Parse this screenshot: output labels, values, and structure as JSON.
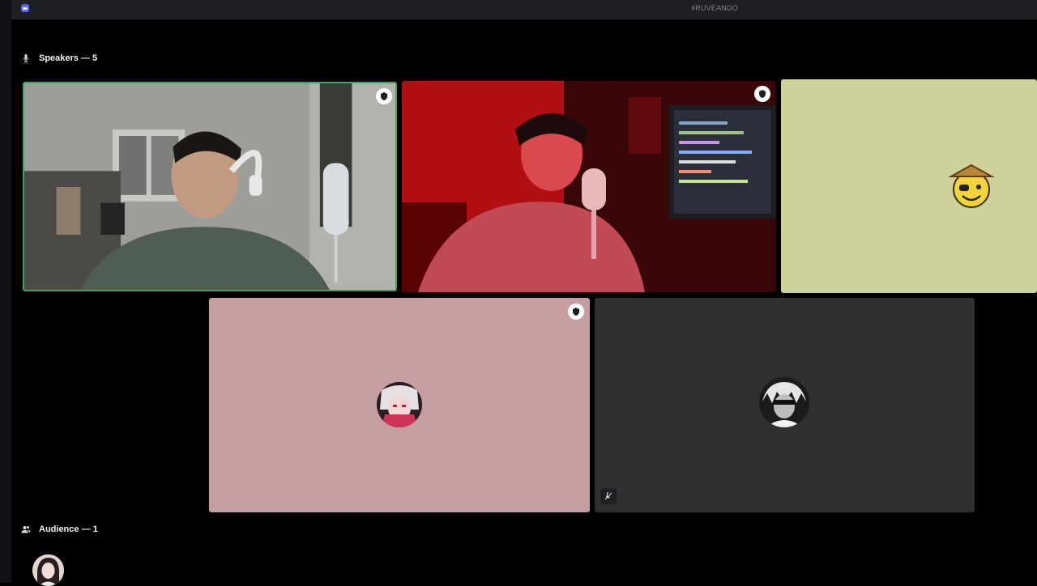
{
  "window": {
    "channel_name": "#RUVEANDO",
    "app_icon": "discord-icon"
  },
  "speakers": {
    "header": "Speakers — 5",
    "icon": "microphone-icon"
  },
  "audience": {
    "header": "Audience — 1",
    "icon": "users-icon"
  },
  "tiles": [
    {
      "type": "video",
      "speaking": true,
      "moderator": true
    },
    {
      "type": "video",
      "speaking": false,
      "moderator": true
    },
    {
      "type": "avatar",
      "background": "#cfd19a",
      "moderator": false
    },
    {
      "type": "avatar",
      "background": "#c69ea2",
      "moderator": true
    },
    {
      "type": "avatar",
      "background": "#2f2f2f",
      "muted": true
    }
  ],
  "colors": {
    "speaking_ring": "#3ba55d",
    "titlebar": "#1e1f22",
    "brand": "#5865f2"
  }
}
